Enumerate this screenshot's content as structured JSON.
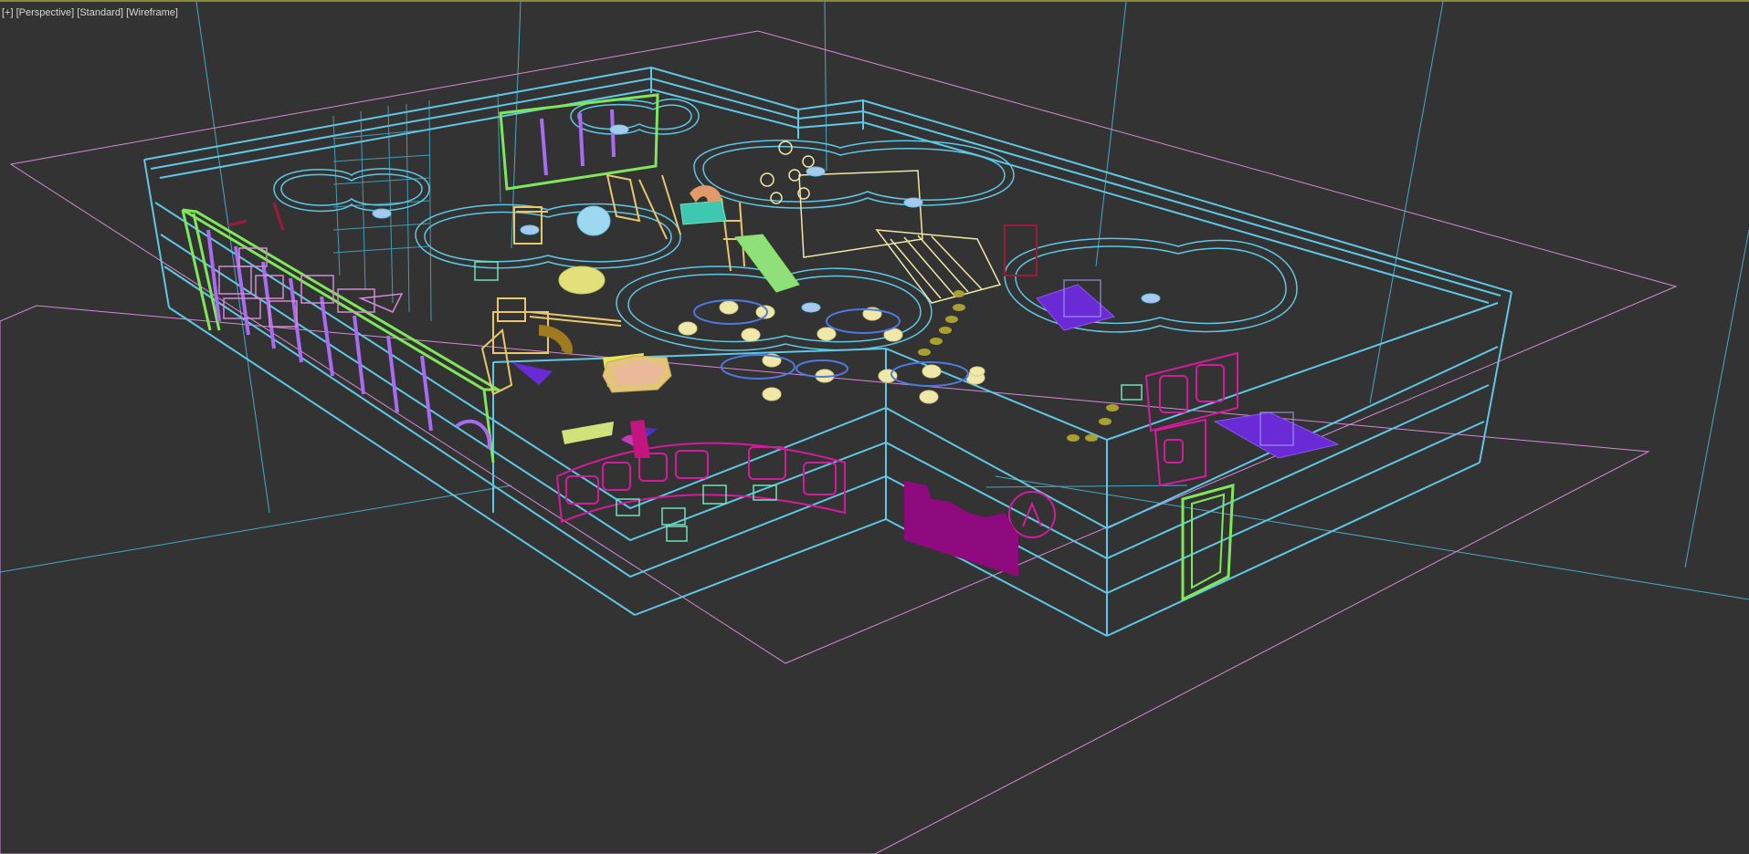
{
  "viewport": {
    "label_plus": "[+]",
    "label_view": "[Perspective]",
    "label_shading": "[Standard]",
    "label_mode": "[Wireframe]"
  },
  "colors": {
    "background": "#333333",
    "walls": "#5ec8e6",
    "ground_plane": "#d58ad8",
    "railing": "#7fe85a",
    "panels": "#d41b9e",
    "stools": "#f2e7a6",
    "climbing": "#e8c86a",
    "ramps": "#6a2bd6"
  },
  "icons": {
    "scene": "wireframe-playground-model"
  }
}
